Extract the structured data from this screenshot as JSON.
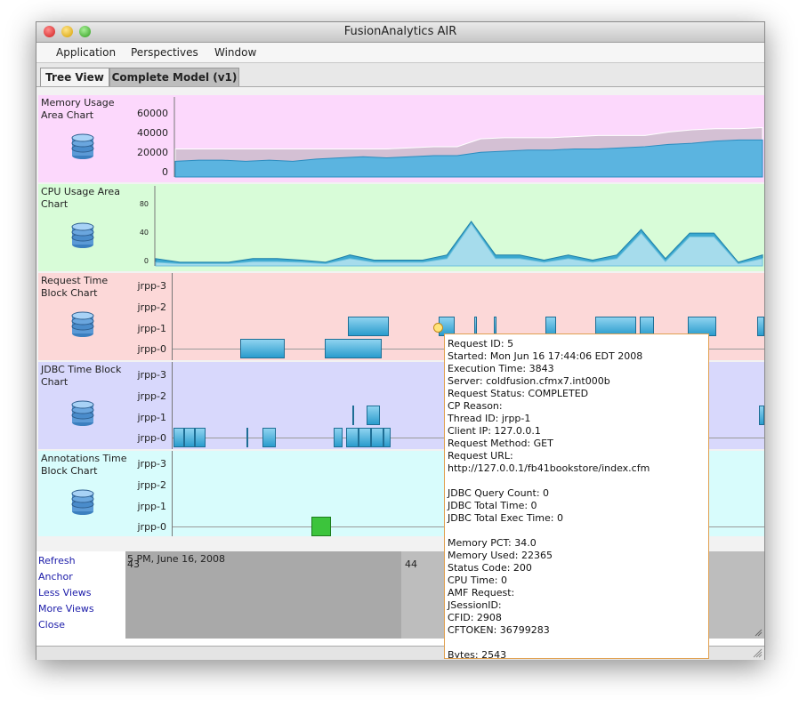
{
  "window": {
    "title": "FusionAnalytics AIR"
  },
  "menu": [
    "Application",
    "Perspectives",
    "Window"
  ],
  "tabs": [
    {
      "label": "Tree View"
    },
    {
      "label": "Complete Model (v1)"
    }
  ],
  "panels": {
    "memory": {
      "label": "Memory Usage Area Chart",
      "bg": "#fcd8fc",
      "y_ticks": [
        "60000",
        "40000",
        "20000",
        "0"
      ]
    },
    "cpu": {
      "label": "CPU Usage Area Chart",
      "bg": "#d8fcd8",
      "y_ticks": [
        "80",
        "40",
        "0"
      ]
    },
    "request": {
      "label": "Request Time Block Chart",
      "bg": "#fcd8d8",
      "y_ticks": [
        "jrpp-3",
        "jrpp-2",
        "jrpp-1",
        "jrpp-0"
      ]
    },
    "jdbc": {
      "label": "JDBC Time Block Chart",
      "bg": "#d8d8fc",
      "y_ticks": [
        "jrpp-3",
        "jrpp-2",
        "jrpp-1",
        "jrpp-0"
      ]
    },
    "annotations": {
      "label": "Annotations Time Block Chart",
      "bg": "#d8fcfc",
      "y_ticks": [
        "jrpp-3",
        "jrpp-2",
        "jrpp-1",
        "jrpp-0"
      ]
    }
  },
  "chart_data": [
    {
      "type": "area",
      "ylim": [
        0,
        65000
      ],
      "series": [
        {
          "values": [
            25000,
            25000,
            25000,
            25000,
            25000,
            25000,
            25000,
            25000,
            25000,
            25000,
            26000,
            27000,
            27000,
            34000,
            35000,
            35000,
            35000,
            36000,
            37000,
            37000,
            37000,
            40000,
            42000,
            43000,
            43000,
            44000
          ]
        },
        {
          "values": [
            14000,
            15000,
            15000,
            14000,
            15000,
            14000,
            16000,
            17000,
            18000,
            17000,
            18000,
            19000,
            19000,
            22000,
            23000,
            24000,
            24000,
            25000,
            25000,
            26000,
            27000,
            29000,
            30000,
            32000,
            33000,
            33000
          ]
        }
      ]
    },
    {
      "type": "area",
      "ylim": [
        0,
        100
      ],
      "series": [
        {
          "values": [
            10,
            5,
            5,
            5,
            10,
            10,
            8,
            5,
            15,
            8,
            8,
            8,
            15,
            61,
            15,
            15,
            8,
            15,
            8,
            15,
            50,
            10,
            45,
            45,
            5,
            15
          ]
        },
        {
          "values": [
            5,
            3,
            3,
            3,
            6,
            6,
            5,
            3,
            10,
            5,
            5,
            5,
            10,
            58,
            10,
            10,
            5,
            10,
            5,
            10,
            45,
            6,
            40,
            40,
            3,
            10
          ]
        }
      ]
    }
  ],
  "links": [
    "Refresh",
    "Anchor",
    "Less Views",
    "More Views",
    "Close"
  ],
  "timeline": {
    "date_label": "5 PM, June 16, 2008",
    "tick_43": "43",
    "tick_44": "44"
  },
  "tooltip": {
    "lines": [
      "Request ID: 5",
      "Started: Mon Jun 16 17:44:06 EDT 2008",
      "Execution Time: 3843",
      "Server: coldfusion.cfmx7.int000b",
      "Request Status: COMPLETED",
      "CP Reason:",
      "Thread ID: jrpp-1",
      "Client IP: 127.0.0.1",
      "Request Method: GET",
      "Request URL:",
      "http://127.0.0.1/fb41bookstore/index.cfm",
      "",
      "JDBC Query Count: 0",
      "JDBC Total Time: 0",
      "JDBC Total Exec Time: 0",
      "",
      "Memory PCT: 34.0",
      "Memory Used: 22365",
      "Status Code: 200",
      "CPU Time: 0",
      "AMF Request:",
      "JSessionID:",
      "CFID: 2908",
      "CFTOKEN: 36799283",
      "",
      "Bytes: 2543"
    ]
  }
}
